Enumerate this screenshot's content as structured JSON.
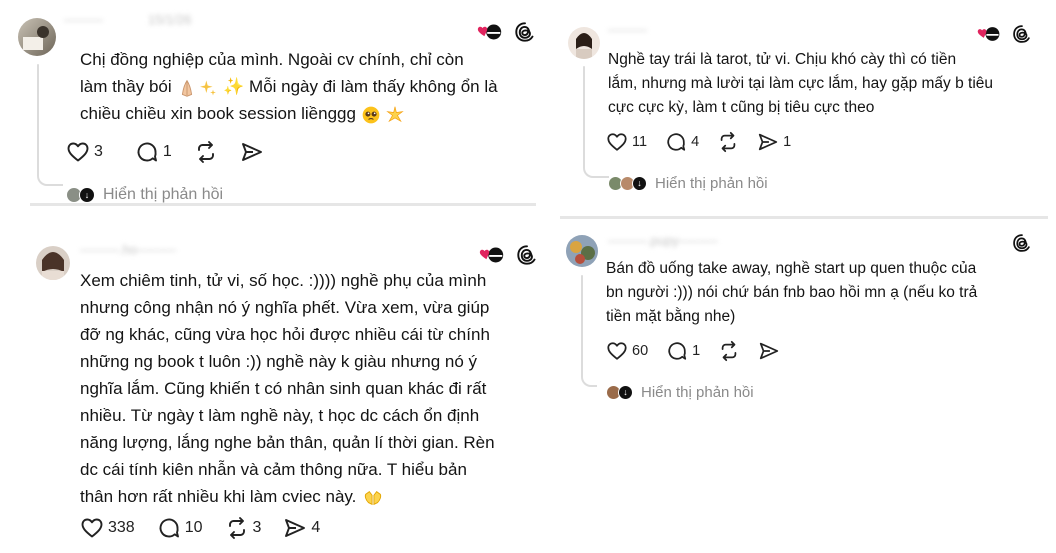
{
  "posts": [
    {
      "username": "———",
      "timestamp": "15/1/26",
      "lines": [
        "Chị đồng nghiệp của mình. Ngoài cv chính, chỉ còn",
        "làm thầy bói",
        "✨ Mỗi ngày đi làm thấy không ổn là",
        "chiều chiều xin book session liềnggg"
      ],
      "likes": "3",
      "comments": "1",
      "reposts": "",
      "shares": "",
      "replies_label": "Hiển thị phản hồi"
    },
    {
      "username": "———",
      "lines": [
        "Nghề tay trái là tarot, tử vi. Chịu khó cày thì có tiền",
        "lắm, nhưng mà lười tại làm cực lắm, hay gặp mấy b tiêu",
        "cực cực kỳ, làm t cũng bị tiêu cực theo"
      ],
      "likes": "11",
      "comments": "4",
      "reposts": "",
      "shares": "1",
      "replies_label": "Hiển thị phản hồi"
    },
    {
      "username": "———.ho———",
      "lines": [
        "Xem chiêm tinh, tử vi, số học. :)))) nghề phụ của mình",
        "nhưng công nhận nó ý nghĩa phết. Vừa xem, vừa giúp",
        "đỡ ng khác, cũng vừa học hỏi được nhiều cái từ chính",
        "những ng book t luôn :)) nghề này k giàu nhưng nó ý",
        "nghĩa lắm. Cũng khiến t có nhân sinh quan khác đi rất",
        "nhiều. Từ ngày t làm nghề này, t học dc cách ổn định",
        "năng lượng, lắng nghe bản thân, quản lí thời gian. Rèn",
        "dc cái tính kiên nhẫn và cảm thông nữa. T hiểu bản",
        "thân hơn rất nhiều khi làm cviec này."
      ],
      "likes": "338",
      "comments": "10",
      "reposts": "3",
      "shares": "4"
    },
    {
      "username": "———.pupy———",
      "lines": [
        "Bán đồ uống take away, nghề start up quen thuộc của",
        "bn người :))) nói chứ bán fnb bao hồi mn ạ (nếu ko trả",
        "tiền mặt bằng nhe)"
      ],
      "likes": "60",
      "comments": "1",
      "reposts": "",
      "shares": "",
      "replies_label": "Hiển thị phản hồi"
    }
  ],
  "colors": {
    "heart_badge": "#e0245e",
    "text": "#141414",
    "muted": "#8a8a8a",
    "line": "#dcdcdc"
  }
}
